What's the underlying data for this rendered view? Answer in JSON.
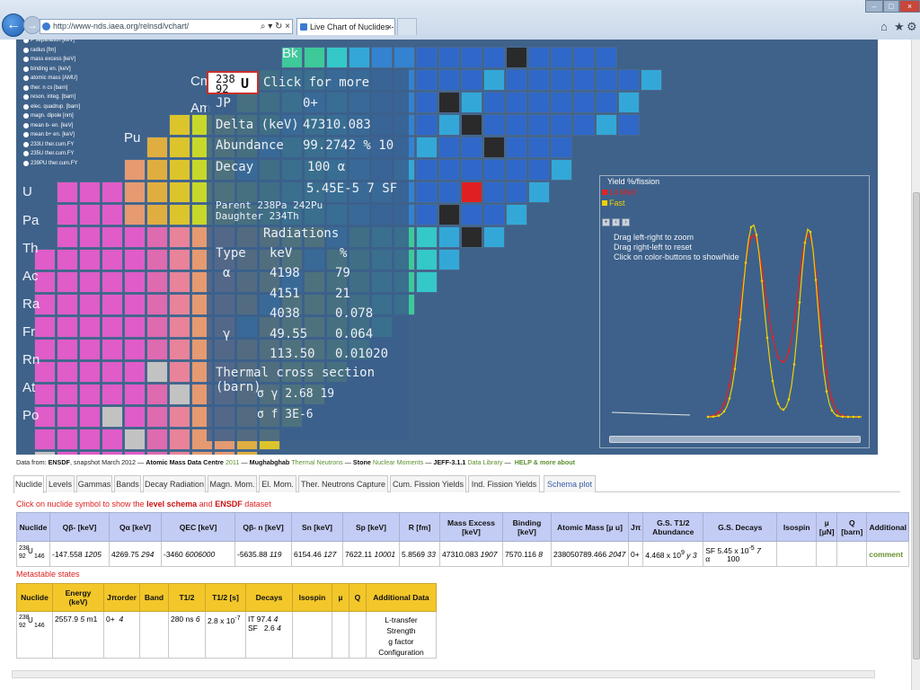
{
  "browser": {
    "url": "http://www-nds.iaea.org/relnsd/vchart/",
    "address_tools": "⌕ ▾ ↻ ×",
    "tab_title": "Live Chart of Nuclides - Ta...",
    "tab_close": "×",
    "win_min": "–",
    "win_max": "□",
    "win_close": "×",
    "back_glyph": "←",
    "fwd_glyph": "→",
    "icons": [
      "home-icon",
      "star-icon",
      "gear-icon"
    ]
  },
  "chart": {
    "element_labels": [
      "Bk",
      "Cm",
      "Am",
      "Pu",
      "U",
      "Pa",
      "Th",
      "Ac",
      "Ra",
      "Fr",
      "Rn",
      "At",
      "Po"
    ],
    "property_menu": [
      "P separation [keV]",
      "radius [fm]",
      "mass excess [keV]",
      "binding en. [keV]",
      "atomic mass [AMU]",
      "ther. n cs [barn]",
      "reson. integ. [barn]",
      "elec. quadrup. [barn]",
      "magn. dipole [nm]",
      "mean b- en. [keV]",
      "mean b+ en. [keV]",
      "233U ther.cum.FY",
      "235U ther.cum.FY",
      "239PU ther.cum.FY"
    ],
    "colors": {
      "background": "#3f628a",
      "selected": "#e02020",
      "pink": "#e05cc8",
      "teal": "#34c8b8",
      "yellow": "#e0d818",
      "green": "#62c44a",
      "blue": "#2f68c8"
    }
  },
  "info_panel": {
    "symbol_a": "238",
    "symbol_z": "92",
    "symbol_el": "U",
    "click_more": "Click for more",
    "jp_label": "JP",
    "jp_value": "0+",
    "delta_label": "Delta (keV)",
    "delta_value": "47310.083",
    "abundance_label": "Abundance",
    "abundance_value": "99.2742 % 10",
    "decay_label": "Decay",
    "decay_value1": "100 α",
    "decay_value2": "5.45E-5 7 SF",
    "parent": "Parent  238Pa 242Pu",
    "daughter": "Daughter 234Th",
    "radiations_title": "Radiations",
    "rad_headers": [
      "Type",
      "keV",
      "%"
    ],
    "radiations": [
      {
        "type": "α",
        "kev": "4198",
        "pct": "79"
      },
      {
        "type": "",
        "kev": "4151",
        "pct": "21"
      },
      {
        "type": "",
        "kev": "4038",
        "pct": "0.078"
      },
      {
        "type": "γ",
        "kev": "49.55",
        "pct": "0.064"
      },
      {
        "type": "",
        "kev": "113.50",
        "pct": "0.01020"
      }
    ],
    "thermal_title": "Thermal cross section (barn)",
    "thermal_gamma": "σ γ 2.68 19",
    "thermal_fission": "σ f 3E-6"
  },
  "yield_plot": {
    "title": "Yield %/fission",
    "legend": [
      "14 MeV",
      "Fast"
    ],
    "legend_colors": [
      "#e82020",
      "#f2d000"
    ],
    "zoom_buttons": [
      "+",
      "‹",
      "›"
    ],
    "hints": [
      "Drag left-right to zoom",
      "Drag right-left to reset",
      "Click on color-buttons to show/hide"
    ]
  },
  "credits": {
    "prefix": "Data from:",
    "ensdf": "ENSDF",
    "snapshot": ", snapshot March 2012 —",
    "ame": "Atomic Mass Data Centre",
    "ame_year": "2011",
    "dash1": "—",
    "mughabghab": "Mughabghab",
    "thermal": "Thermal Neutrons",
    "dash2": "—",
    "stone": "Stone",
    "nuclear_moments": "Nuclear Moments",
    "dash3": "—",
    "jeff": "JEFF-3.1.1",
    "data_library": "Data Library",
    "dash4": "—",
    "help": "HELP & more about"
  },
  "tabs": [
    "Nuclide",
    "Levels",
    "Gammas",
    "Bands",
    "Decay Radiation",
    "Magn. Mom.",
    "El. Mom.",
    "Ther. Neutrons Capture",
    "Cum. Fission Yields",
    "Ind. Fission Yields",
    "Schema plot"
  ],
  "hint": {
    "pre": "Click on nuclide symbol to show the",
    "level_schema": "level schema",
    "mid": "and",
    "ensdf": "ENSDF",
    "post": "dataset"
  },
  "ground_state": {
    "headers": [
      "Nuclide",
      "Qβ- [keV]",
      "Qα [keV]",
      "QEC [keV]",
      "Qβ- n [keV]",
      "Sn [keV]",
      "Sp [keV]",
      "R [fm]",
      "Mass Excess [keV]",
      "Binding [keV]",
      "Atomic Mass [µ u]",
      "Jπ",
      "G.S. T1/2 Abundance",
      "G.S. Decays",
      "Isospin",
      "µ [µN]",
      "Q [barn]",
      "Additional"
    ],
    "row": {
      "nuc_a": "238",
      "nuc_z": "92",
      "nuc_el": "U",
      "nuc_n": "146",
      "qbm": "-147.558",
      "qbm_unc": "1205",
      "qa": "4269.75",
      "qa_unc": "294",
      "qec": "-3460",
      "qec_unc": "6006000",
      "qbn": "-5635.88",
      "qbn_unc": "119",
      "sn": "6154.46",
      "sn_unc": "127",
      "sp": "7622.11",
      "sp_unc": "10001",
      "r": "5.8569",
      "r_unc": "33",
      "mass_excess": "47310.083",
      "mass_excess_unc": "1907",
      "binding": "7570.116",
      "binding_unc": "8",
      "atomic_mass": "238050789.466",
      "atomic_mass_unc": "2047",
      "jpi": "0+",
      "t12": "4.468 x 10",
      "t12_exp": "9",
      "t12_unit": "y",
      "t12_unc": "3",
      "decay1": "SF  5.45 x 10",
      "decay1_exp": "-5",
      "decay1_unc": "7",
      "decay2": "α        100",
      "additional": "comment"
    }
  },
  "metastable": {
    "label": "Metastable states",
    "headers": [
      "Nuclide",
      "Energy (keV)",
      "Jπorder",
      "Band",
      "T1/2",
      "T1/2 [s]",
      "Decays",
      "Isospin",
      "µ",
      "Q",
      "Additional Data"
    ],
    "row": {
      "nuc_a": "238",
      "nuc_z": "92",
      "nuc_el": "U",
      "nuc_n": "146",
      "energy": "2557.9",
      "energy_unc": "5",
      "energy_label": "m1",
      "jpi": "0+",
      "jpi_order": "4",
      "t12": "280 ns",
      "t12_unc": "6",
      "t12s": "2.8 x 10",
      "t12s_exp": "-7",
      "decay1": "IT  97.4",
      "decay1_unc": "4",
      "decay2": "SF   2.6",
      "decay2_unc": "4",
      "additional": [
        "L-transfer",
        "Strength",
        "g factor",
        "Configuration"
      ]
    }
  }
}
